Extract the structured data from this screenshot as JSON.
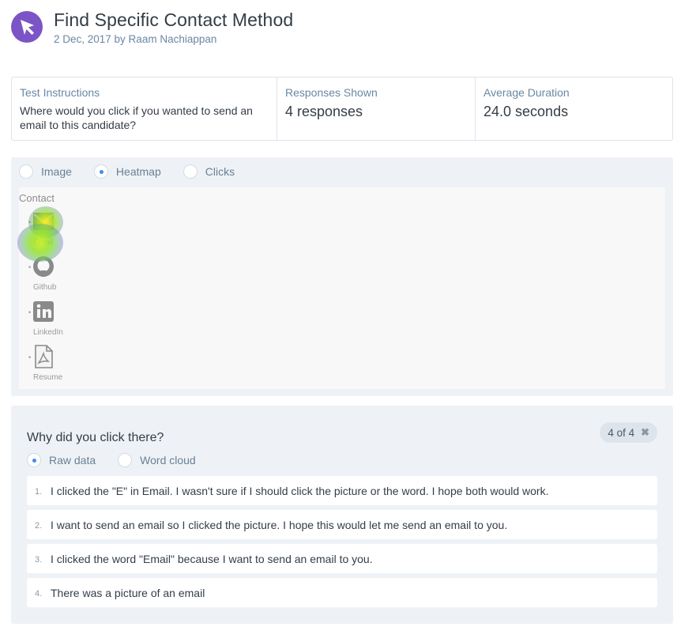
{
  "header": {
    "title": "Find Specific Contact Method",
    "subtitle": "2 Dec, 2017 by Raam Nachiappan"
  },
  "stats": {
    "instructions_label": "Test Instructions",
    "instructions_text": "Where would you click if you wanted to send an email to this candidate?",
    "responses_label": "Responses Shown",
    "responses_value": "4 responses",
    "duration_label": "Average Duration",
    "duration_value": "24.0 seconds"
  },
  "view_options": {
    "image": "Image",
    "heatmap": "Heatmap",
    "clicks": "Clicks",
    "selected": "Heatmap"
  },
  "contact_image": {
    "title": "Contact",
    "items": [
      {
        "label": "Email",
        "icon": "envelope-icon"
      },
      {
        "label": "Github",
        "icon": "github-icon"
      },
      {
        "label": "LinkedIn",
        "icon": "linkedin-icon"
      },
      {
        "label": "Resume",
        "icon": "pdf-icon"
      }
    ]
  },
  "responses": {
    "question": "Why did you click there?",
    "count": "4 of 4",
    "mode_raw": "Raw data",
    "mode_cloud": "Word cloud",
    "selected_mode": "Raw data",
    "items": [
      {
        "num": "1.",
        "text": "I clicked the \"E\" in Email. I wasn't sure if I should click the picture or the word. I hope both would work."
      },
      {
        "num": "2.",
        "text": "I want to send an email so I clicked the picture. I hope this would let me send an email to you."
      },
      {
        "num": "3.",
        "text": "I clicked the word \"Email\" because I want to send an email to you."
      },
      {
        "num": "4.",
        "text": "There was a picture of an email"
      }
    ]
  },
  "colors": {
    "brand": "#7b55c6",
    "radio_selected": "#3e8ee8",
    "panel_bg": "#eef2f6",
    "muted_text": "#6a87a3"
  }
}
